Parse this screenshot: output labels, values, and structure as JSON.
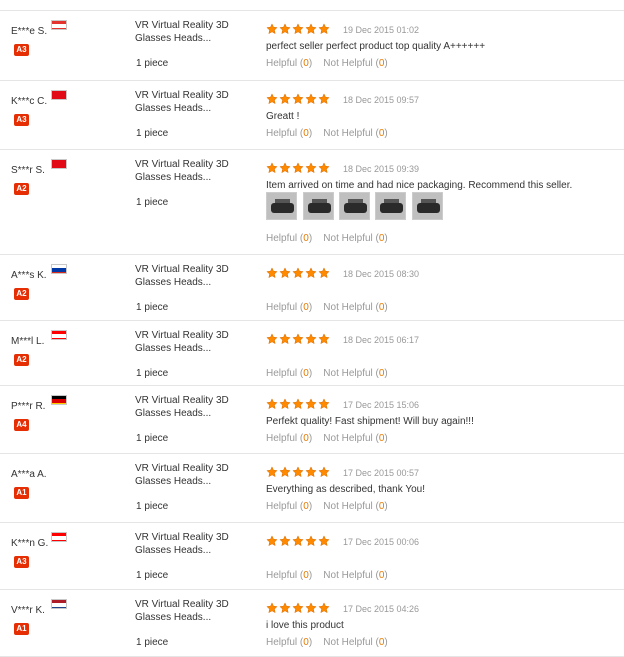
{
  "reviews": [
    {
      "buyer": "E***e S.",
      "country": "Lebanon",
      "flag": [
        "#e3342f",
        "#ffffff",
        "#e3342f"
      ],
      "level": "A3",
      "level_color": "#e62e04",
      "product": "VR Virtual Reality 3D Glasses Heads...",
      "quantity": "1 piece",
      "rating": 5,
      "date": "19 Dec 2015 01:02",
      "text": "perfect seller perfect product top quality A++++++",
      "helpful_label": "Helpful",
      "helpful_count": "0",
      "not_helpful_label": "Not Helpful",
      "not_helpful_count": "0",
      "photos": []
    },
    {
      "buyer": "K***c C.",
      "country": "Turkey",
      "flag": [
        "#e30a17",
        "#e30a17",
        "#e30a17"
      ],
      "level": "A3",
      "level_color": "#e62e04",
      "product": "VR Virtual Reality 3D Glasses Heads...",
      "quantity": "1 piece",
      "rating": 5,
      "date": "18 Dec 2015 09:57",
      "text": "Greatt !",
      "helpful_label": "Helpful",
      "helpful_count": "0",
      "not_helpful_label": "Not Helpful",
      "not_helpful_count": "0",
      "photos": []
    },
    {
      "buyer": "S***r S.",
      "country": "Turkey",
      "flag": [
        "#e30a17",
        "#e30a17",
        "#e30a17"
      ],
      "level": "A2",
      "level_color": "#e62e04",
      "product": "VR Virtual Reality 3D Glasses Heads...",
      "quantity": "1 piece",
      "rating": 5,
      "date": "18 Dec 2015 09:39",
      "text": "Item arrived on time and had nice packaging. Recommend this seller.",
      "helpful_label": "Helpful",
      "helpful_count": "0",
      "not_helpful_label": "Not Helpful",
      "not_helpful_count": "0",
      "photos": [
        "photo-1",
        "photo-2",
        "photo-3",
        "photo-4",
        "photo-5"
      ]
    },
    {
      "buyer": "A***s K.",
      "country": "Russia",
      "flag": [
        "#ffffff",
        "#0039a6",
        "#d52b1e"
      ],
      "level": "A2",
      "level_color": "#e62e04",
      "product": "VR Virtual Reality 3D Glasses Heads...",
      "quantity": "1 piece",
      "rating": 5,
      "date": "18 Dec 2015 08:30",
      "text": "",
      "helpful_label": "Helpful",
      "helpful_count": "0",
      "not_helpful_label": "Not Helpful",
      "not_helpful_count": "0",
      "photos": []
    },
    {
      "buyer": "M***l L.",
      "country": "Canada",
      "flag": [
        "#ff0000",
        "#ffffff",
        "#ff0000"
      ],
      "level": "A2",
      "level_color": "#e62e04",
      "product": "VR Virtual Reality 3D Glasses Heads...",
      "quantity": "1 piece",
      "rating": 5,
      "date": "18 Dec 2015 06:17",
      "text": "",
      "helpful_label": "Helpful",
      "helpful_count": "0",
      "not_helpful_label": "Not Helpful",
      "not_helpful_count": "0",
      "photos": []
    },
    {
      "buyer": "P***r R.",
      "country": "Germany",
      "flag": [
        "#000000",
        "#dd0000",
        "#ffce00"
      ],
      "level": "A4",
      "level_color": "#e62e04",
      "product": "VR Virtual Reality 3D Glasses Heads...",
      "quantity": "1 piece",
      "rating": 5,
      "date": "17 Dec 2015 15:06",
      "text": "Perfekt quality! Fast shipment! Will buy again!!!",
      "helpful_label": "Helpful",
      "helpful_count": "0",
      "not_helpful_label": "Not Helpful",
      "not_helpful_count": "0",
      "photos": []
    },
    {
      "buyer": "A***a A.",
      "country": "",
      "flag": [],
      "level": "A1",
      "level_color": "#e62e04",
      "product": "VR Virtual Reality 3D Glasses Heads...",
      "quantity": "1 piece",
      "rating": 5,
      "date": "17 Dec 2015 00:57",
      "text": "Everything as described, thank You!",
      "helpful_label": "Helpful",
      "helpful_count": "0",
      "not_helpful_label": "Not Helpful",
      "not_helpful_count": "0",
      "photos": []
    },
    {
      "buyer": "K***n G.",
      "country": "Canada",
      "flag": [
        "#ff0000",
        "#ffffff",
        "#ff0000"
      ],
      "level": "A3",
      "level_color": "#e62e04",
      "product": "VR Virtual Reality 3D Glasses Heads...",
      "quantity": "1 piece",
      "rating": 5,
      "date": "17 Dec 2015 00:06",
      "text": "",
      "helpful_label": "Helpful",
      "helpful_count": "0",
      "not_helpful_label": "Not Helpful",
      "not_helpful_count": "0",
      "photos": []
    },
    {
      "buyer": "V***r K.",
      "country": "Netherlands",
      "flag": [
        "#ae1c28",
        "#ffffff",
        "#21468b"
      ],
      "level": "A1",
      "level_color": "#e62e04",
      "product": "VR Virtual Reality 3D Glasses Heads...",
      "quantity": "1 piece",
      "rating": 5,
      "date": "17 Dec 2015 04:26",
      "text": "i love this product",
      "helpful_label": "Helpful",
      "helpful_count": "0",
      "not_helpful_label": "Not Helpful",
      "not_helpful_count": "0",
      "photos": []
    }
  ],
  "colors": {
    "star": "#ff8a00",
    "star_stroke": "#d86a00",
    "accent": "#e67a00",
    "muted": "#999999",
    "divider": "#e5e5e5"
  },
  "icons": {
    "star": "star-icon",
    "flag": "country-flag-icon",
    "photo": "review-photo-thumbnail"
  }
}
